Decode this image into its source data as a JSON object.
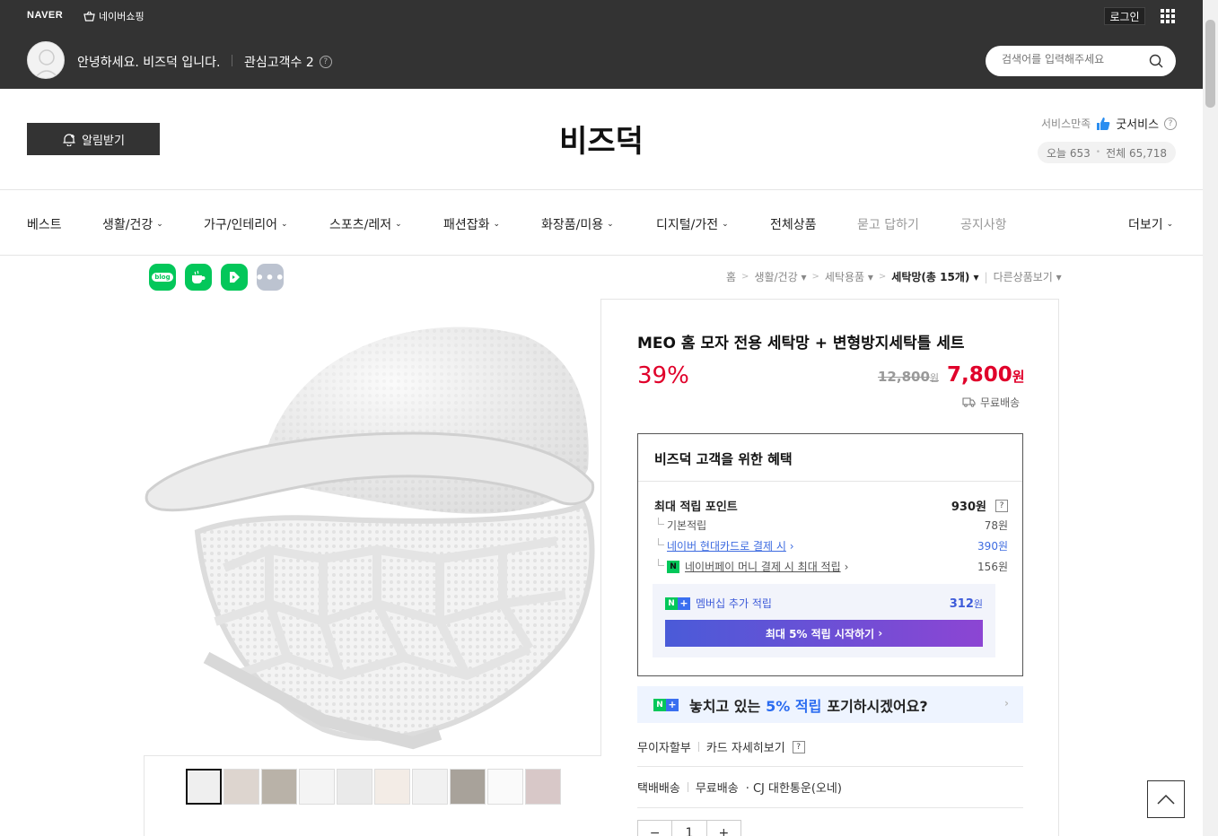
{
  "top": {
    "brand": "NAVER",
    "shopping_link": "네이버쇼핑",
    "login_label": "로그인",
    "greeting": "안녕하세요. 비즈덕 입니다.",
    "interest": "관심고객수 2",
    "help_mark": "?",
    "search_placeholder": "검색어를 입력해주세요"
  },
  "store": {
    "notify_label": "알림받기",
    "title": "비즈덕",
    "service_label": "서비스만족",
    "service_grade": "굿서비스",
    "help_mark": "?",
    "today": "오늘 653",
    "dot": "•",
    "total": "전체 65,718"
  },
  "nav": {
    "items": [
      {
        "label": "베스트"
      },
      {
        "label": "생활/건강"
      },
      {
        "label": "가구/인테리어"
      },
      {
        "label": "스포츠/레저"
      },
      {
        "label": "패션잡화"
      },
      {
        "label": "화장품/미용"
      },
      {
        "label": "디지털/가전"
      },
      {
        "label": "전체상품"
      },
      {
        "label": "묻고 답하기"
      },
      {
        "label": "공지사항"
      },
      {
        "label": "더보기"
      }
    ]
  },
  "share": {
    "blog": "blog"
  },
  "breadcrumb": {
    "home": "홈",
    "sep": ">",
    "c1": "생활/건강",
    "c2": "세탁용품",
    "c3": "세탁망(총 15개)",
    "other": "다른상품보기"
  },
  "product": {
    "title": "MEO 홈 모자 전용 세탁망 + 변형방지세탁틀 세트",
    "discount": "39%",
    "original_price": "12,800",
    "price": "7,800",
    "won": "원",
    "shipping": "무료배송"
  },
  "benefit": {
    "title": "비즈덕 고객을 위한 혜택",
    "max_point_label": "최대 적립 포인트",
    "max_point_value": "930원",
    "help_mark": "?",
    "basic_label": "기본적립",
    "basic_value": "78원",
    "card_label": "네이버 현대카드로 결제 시",
    "card_value": "390원",
    "npay_label": "네이버페이 머니 결제 시 최대 적립",
    "npay_value": "156원",
    "npay_badge": "N",
    "member_label": "멤버십 추가 적립",
    "member_value": "312",
    "member_unit": "원",
    "member_btn": "최대 5% 적립 시작하기",
    "badge_n": "N",
    "badge_plus": "+"
  },
  "banner": {
    "pre": "놓치고 있는",
    "highlight": "5% 적립",
    "post": "포기하시겠어요?",
    "arrow": "›"
  },
  "payment": {
    "installment": "무이자할부",
    "card_detail": "카드 자세히보기",
    "help_mark": "?"
  },
  "delivery": {
    "method": "택배배송",
    "fee": "무료배송",
    "carrier": "· CJ 대한통운(오네)"
  },
  "quantity": {
    "minus": "−",
    "value": "1",
    "plus": "+"
  },
  "colors": {
    "header_bg": "#333333",
    "price_red": "#e0002a",
    "naver_green": "#03c75a",
    "link_blue": "#3d6be0"
  }
}
